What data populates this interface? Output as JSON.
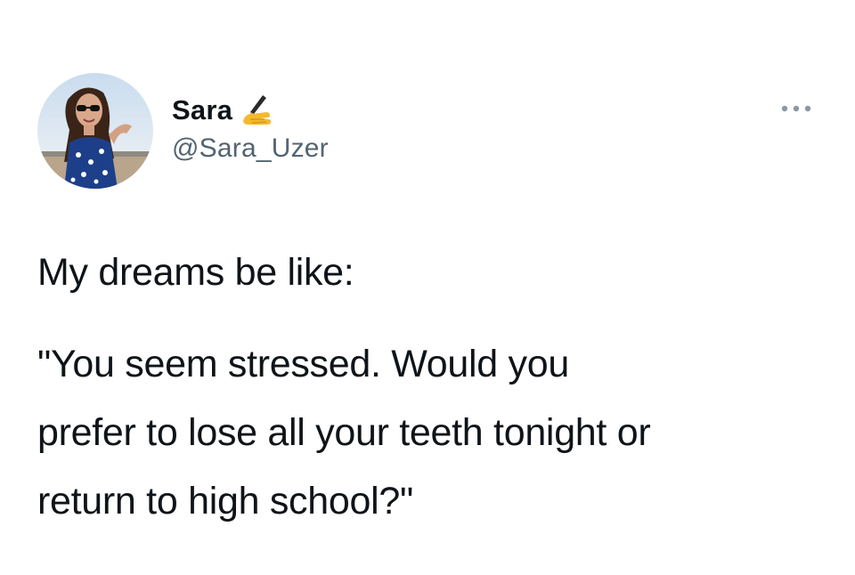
{
  "user": {
    "display_name": "Sara",
    "name_emoji": "writing-hand-icon",
    "handle": "@Sara_Uzer"
  },
  "menu": {
    "icon": "more-options-icon"
  },
  "tweet": {
    "lines": [
      "My dreams be like:",
      "\"You seem stressed. Would you",
      "prefer to lose all your teeth tonight or",
      "return to high school?\""
    ]
  },
  "colors": {
    "text": "#0f1419",
    "secondary_text": "#536471",
    "background": "#ffffff"
  }
}
